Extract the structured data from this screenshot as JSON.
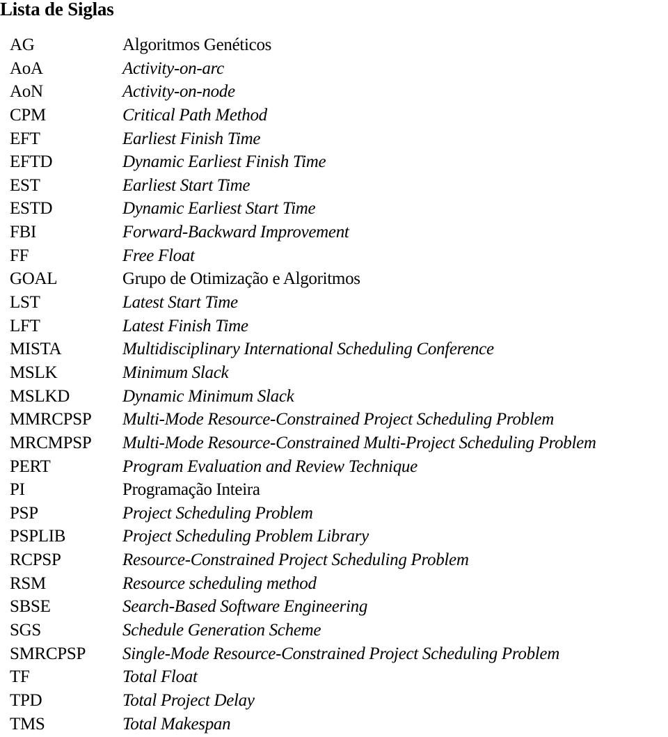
{
  "title": "Lista de Siglas",
  "entries": [
    {
      "acronym": "AG",
      "definition": "Algoritmos Genéticos",
      "italic": false
    },
    {
      "acronym": "AoA",
      "definition": "Activity-on-arc",
      "italic": true
    },
    {
      "acronym": "AoN",
      "definition": "Activity-on-node",
      "italic": true
    },
    {
      "acronym": "CPM",
      "definition": "Critical Path Method",
      "italic": true
    },
    {
      "acronym": "EFT",
      "definition": "Earliest Finish Time",
      "italic": true
    },
    {
      "acronym": "EFTD",
      "definition": "Dynamic Earliest Finish Time",
      "italic": true
    },
    {
      "acronym": "EST",
      "definition": "Earliest Start Time",
      "italic": true
    },
    {
      "acronym": "ESTD",
      "definition": "Dynamic Earliest Start Time",
      "italic": true
    },
    {
      "acronym": "FBI",
      "definition": "Forward-Backward Improvement",
      "italic": true
    },
    {
      "acronym": "FF",
      "definition": "Free Float",
      "italic": true
    },
    {
      "acronym": "GOAL",
      "definition": "Grupo de Otimização e Algoritmos",
      "italic": false
    },
    {
      "acronym": "LST",
      "definition": "Latest Start Time",
      "italic": true
    },
    {
      "acronym": "LFT",
      "definition": "Latest Finish Time",
      "italic": true
    },
    {
      "acronym": "MISTA",
      "definition": "Multidisciplinary International Scheduling Conference",
      "italic": true
    },
    {
      "acronym": "MSLK",
      "definition": "Minimum Slack",
      "italic": true
    },
    {
      "acronym": "MSLKD",
      "definition": "Dynamic Minimum Slack",
      "italic": true
    },
    {
      "acronym": "MMRCPSP",
      "definition": "Multi-Mode Resource-Constrained Project Scheduling Problem",
      "italic": true
    },
    {
      "acronym": "MRCMPSP",
      "definition": "Multi-Mode Resource-Constrained Multi-Project Scheduling Problem",
      "italic": true
    },
    {
      "acronym": "PERT",
      "definition": "Program Evaluation and Review Technique",
      "italic": true
    },
    {
      "acronym": "PI",
      "definition": "Programação Inteira",
      "italic": false
    },
    {
      "acronym": "PSP",
      "definition": "Project Scheduling Problem",
      "italic": true
    },
    {
      "acronym": "PSPLIB",
      "definition": "Project Scheduling Problem Library",
      "italic": true
    },
    {
      "acronym": "RCPSP",
      "definition": "Resource-Constrained Project Scheduling Problem",
      "italic": true
    },
    {
      "acronym": "RSM",
      "definition": "Resource scheduling method",
      "italic": true
    },
    {
      "acronym": "SBSE",
      "definition": "Search-Based Software Engineering",
      "italic": true
    },
    {
      "acronym": "SGS",
      "definition": "Schedule Generation Scheme",
      "italic": true
    },
    {
      "acronym": "SMRCPSP",
      "definition": "Single-Mode Resource-Constrained Project Scheduling Problem",
      "italic": true
    },
    {
      "acronym": "TF",
      "definition": "Total Float",
      "italic": true
    },
    {
      "acronym": "TPD",
      "definition": "Total Project Delay",
      "italic": true
    },
    {
      "acronym": "TMS",
      "definition": "Total Makespan",
      "italic": true
    }
  ]
}
